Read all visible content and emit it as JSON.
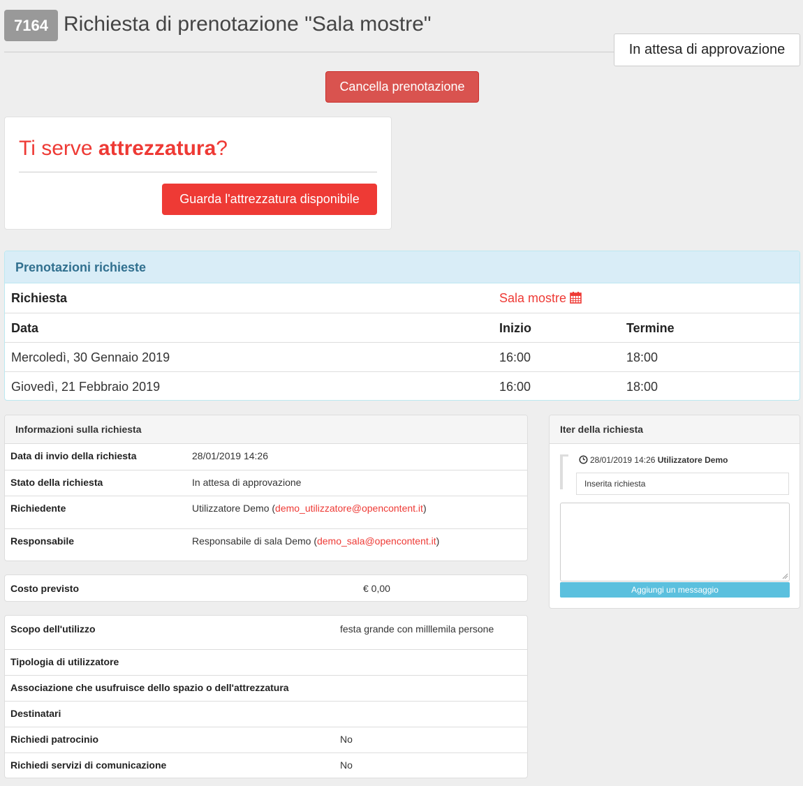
{
  "header": {
    "id": "7164",
    "title": "Richiesta di prenotazione \"Sala mostre\"",
    "status": "In attesa di approvazione"
  },
  "actions": {
    "cancel_label": "Cancella prenotazione"
  },
  "equipment": {
    "title_prefix": "Ti serve ",
    "title_bold": "attrezzatura",
    "title_suffix": "?",
    "button_label": "Guarda l'attrezzatura disponibile"
  },
  "bookings": {
    "heading": "Prenotazioni richieste",
    "request_label": "Richiesta",
    "room_name": "Sala mostre",
    "room_icon": "calendar-icon",
    "columns": [
      "Data",
      "Inizio",
      "Termine"
    ],
    "rows": [
      {
        "date": "Mercoledì, 30 Gennaio 2019",
        "start": "16:00",
        "end": "18:00"
      },
      {
        "date": "Giovedì, 21 Febbraio 2019",
        "start": "16:00",
        "end": "18:00"
      }
    ]
  },
  "info": {
    "heading": "Informazioni sulla richiesta",
    "sent_label": "Data di invio della richiesta",
    "sent_value": "28/01/2019 14:26",
    "state_label": "Stato della richiesta",
    "state_value": "In attesa di approvazione",
    "requester_label": "Richiedente",
    "requester_name": "Utilizzatore Demo (",
    "requester_email": "demo_utilizzatore@opencontent.it",
    "requester_close": ")",
    "manager_label": "Responsabile",
    "manager_name": "Responsabile di sala Demo (",
    "manager_email": "demo_sala@opencontent.it",
    "manager_close": ")"
  },
  "cost": {
    "label": "Costo previsto",
    "value": "€ 0,00"
  },
  "details": {
    "scope_label": "Scopo dell'utilizzo",
    "scope_value": "festa grande con milllemila persone",
    "user_type_label": "Tipologia di utilizzatore",
    "association_label": "Associazione che usufruisce dello spazio o dell'attrezzatura",
    "recipients_label": "Destinatari",
    "patronage_label": "Richiedi patrocinio",
    "patronage_value": "No",
    "communication_label": "Richiedi servizi di comunicazione",
    "communication_value": "No"
  },
  "iter": {
    "heading": "Iter della richiesta",
    "clock_icon": "clock-icon",
    "entry_datetime": "28/01/2019 14:26",
    "entry_user": "Utilizzatore Demo",
    "entry_message": "Inserita richiesta",
    "add_message_label": "Aggiungi un messaggio"
  },
  "colors": {
    "accent_red": "#ee3a35",
    "cancel_red": "#d9534f",
    "info_blue": "#31708f",
    "button_cyan": "#5bc0de"
  }
}
